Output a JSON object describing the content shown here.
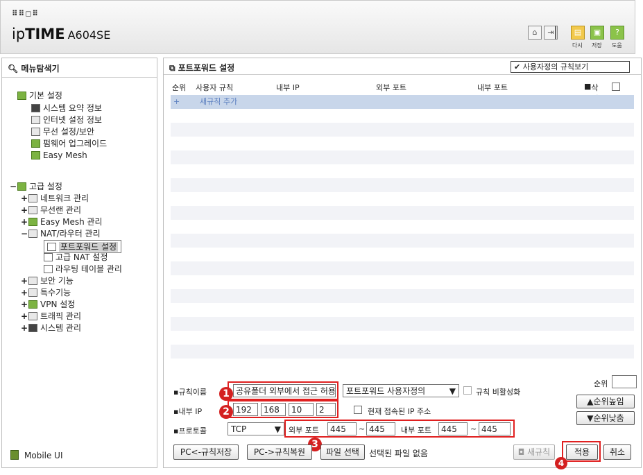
{
  "header": {
    "logo_dots": "⠿⠿◻⠿",
    "brand_prefix": "ip",
    "brand_bold": "TIME",
    "model": "A604SE",
    "buttons": [
      {
        "icon": "home-icon",
        "label": ""
      },
      {
        "icon": "logout-icon",
        "label": ""
      },
      {
        "icon": "reload-icon",
        "label": "다시"
      },
      {
        "icon": "save-icon",
        "label": "저장"
      },
      {
        "icon": "help-icon",
        "label": "도움"
      }
    ]
  },
  "sidebar": {
    "title": "메뉴탐색기",
    "basic": {
      "label": "기본 설정",
      "items": [
        "시스템 요약 정보",
        "인터넷 설정 정보",
        "무선 설정/보안",
        "펌웨어 업그레이드",
        "Easy Mesh"
      ]
    },
    "advanced": {
      "label": "고급 설정",
      "items": [
        {
          "label": "네트워크 관리",
          "pm": "+"
        },
        {
          "label": "무선랜 관리",
          "pm": "+"
        },
        {
          "label": "Easy Mesh 관리",
          "pm": "+"
        },
        {
          "label": "NAT/라우터 관리",
          "pm": "−"
        },
        {
          "label": "보안 기능",
          "pm": "+"
        },
        {
          "label": "특수기능",
          "pm": "+"
        },
        {
          "label": "VPN 설정",
          "pm": "+"
        },
        {
          "label": "트래픽 관리",
          "pm": "+"
        },
        {
          "label": "시스템 관리",
          "pm": "+"
        }
      ],
      "nat_children": [
        "포트포워드 설정",
        "고급 NAT 설정",
        "라우팅 테이블 관리"
      ]
    },
    "mobile_ui": "Mobile UI"
  },
  "main": {
    "title": "포트포워드 설정",
    "view_select": "사용자정의 규칙보기",
    "columns": {
      "order": "순위",
      "rule": "사용자 규칙",
      "internal_ip": "내부 IP",
      "external_port": "외부 포트",
      "internal_port": "내부 포트",
      "delete": "삭제"
    },
    "add_rule_icon": "+",
    "add_rule": "새규칙 추가"
  },
  "form": {
    "rule_name_label": "규칙이름",
    "rule_name_value": "공유폴더 외부에서 접근 허용",
    "rule_type": "포트포워드 사용자정의",
    "disable_rule_label": "규칙 비활성화",
    "internal_ip_label": "내부 IP",
    "ip": [
      "192",
      "168",
      "10",
      "2"
    ],
    "current_ip_label": "현재 접속된 IP 주소",
    "protocol_label": "프로토콜",
    "protocol_value": "TCP",
    "external_port_label": "외부 포트",
    "ext_port_from": "445",
    "ext_port_to": "445",
    "internal_port_label": "내부 포트",
    "int_port_from": "445",
    "int_port_to": "445",
    "order_label": "순위",
    "order_value": "",
    "order_up": "▲순위높임",
    "order_down": "▼순위낮춤",
    "backup_button": "PC<-규칙저장",
    "restore_button": "PC->규칙복원",
    "file_button": "파일 선택",
    "file_status": "선택된 파일 없음",
    "new_rule_button": "새규칙",
    "apply_button": "적용",
    "cancel_button": "취소"
  },
  "annotations": {
    "b1": "1",
    "b2": "2",
    "b3": "3",
    "b4": "4"
  }
}
